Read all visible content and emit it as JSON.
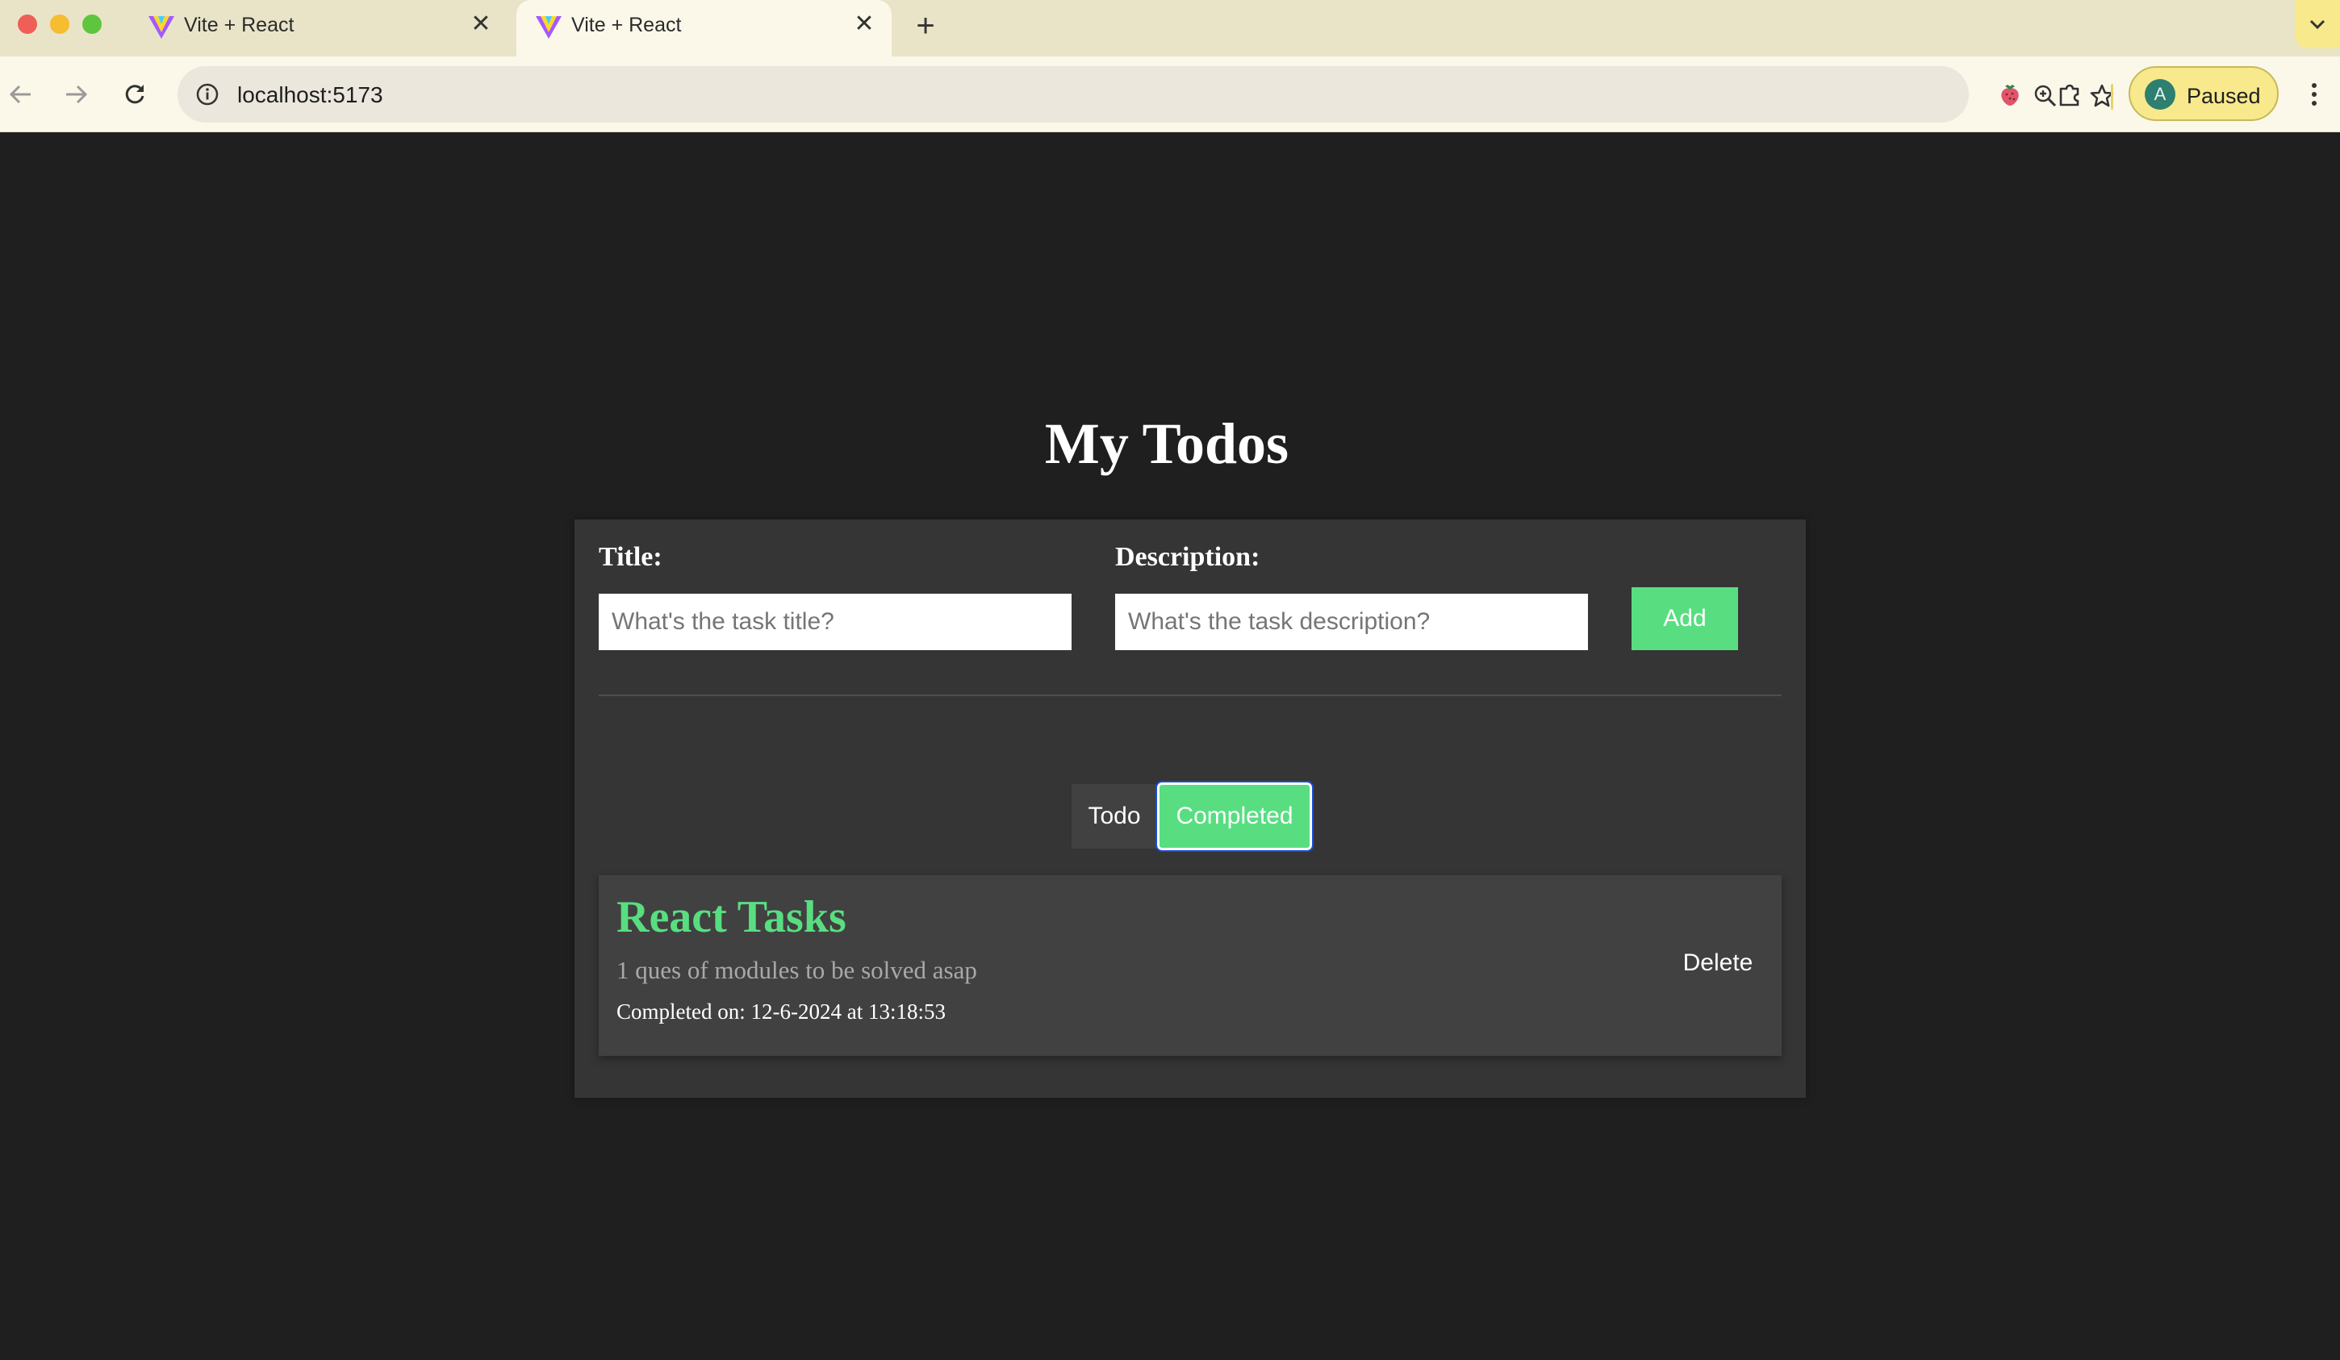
{
  "browser": {
    "tabs": [
      {
        "title": "Vite + React",
        "active": false
      },
      {
        "title": "Vite + React",
        "active": true
      }
    ],
    "url": "localhost:5173",
    "profile": {
      "initial": "A",
      "status": "Paused"
    }
  },
  "app": {
    "heading": "My Todos",
    "form": {
      "title_label": "Title:",
      "title_value": "",
      "title_placeholder": "What's the task title?",
      "description_label": "Description:",
      "description_value": "",
      "description_placeholder": "What's the task description?",
      "add_label": "Add"
    },
    "filters": {
      "todo_label": "Todo",
      "completed_label": "Completed",
      "selected": "Completed"
    },
    "todos": [
      {
        "title": "React Tasks",
        "description": "1 ques of modules to be solved asap",
        "completed_prefix": "Completed on:",
        "completed_on": "12-6-2024 at 13:18:53",
        "delete_label": "Delete"
      }
    ]
  },
  "colors": {
    "accent_green": "#58de80",
    "page_background": "#1f1f1f",
    "panel_background": "#353535",
    "card_background": "#414141",
    "profile_chip": "#f7e98c"
  }
}
